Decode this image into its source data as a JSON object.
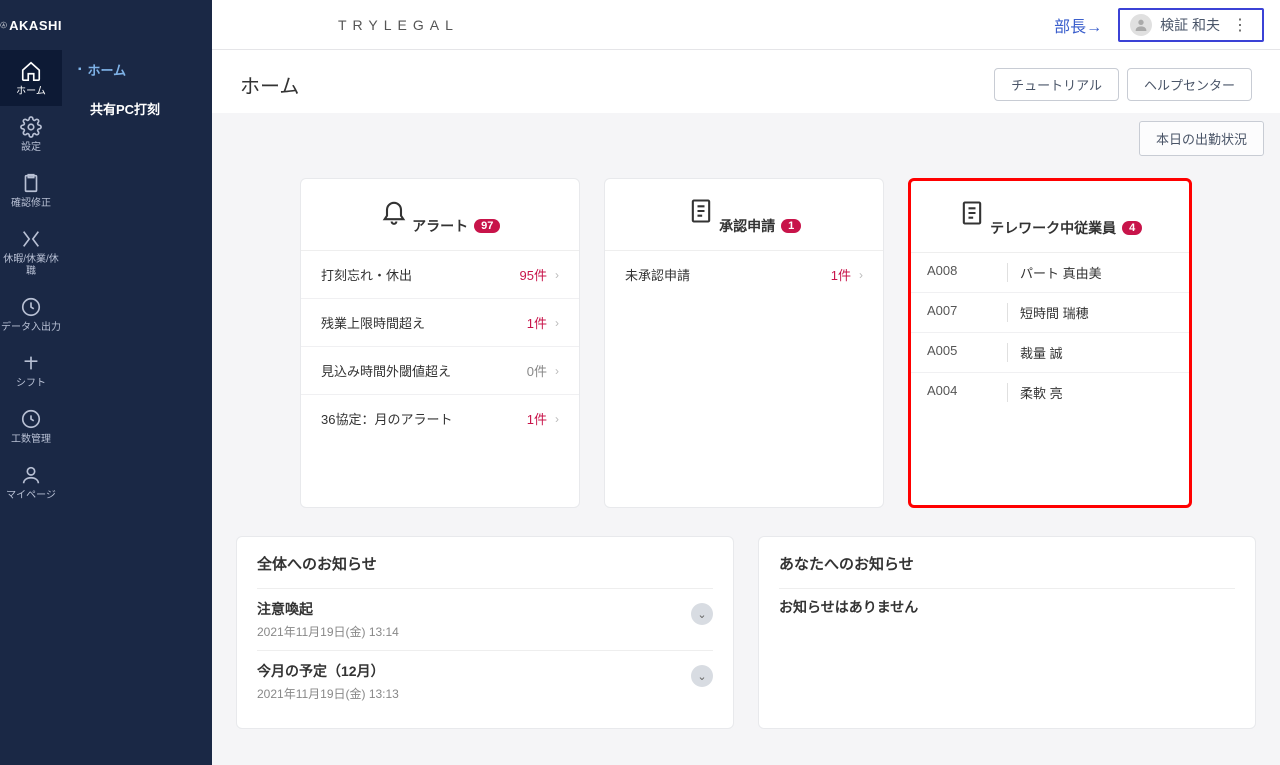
{
  "logo": "AKASHI",
  "icon_rail": [
    {
      "label": "ホーム"
    },
    {
      "label": "設定"
    },
    {
      "label": "確認修正"
    },
    {
      "label": "休暇/休業/休職"
    },
    {
      "label": "データ入出力"
    },
    {
      "label": "シフト"
    },
    {
      "label": "工数管理"
    },
    {
      "label": "マイページ"
    }
  ],
  "sub_sidebar": [
    {
      "label": "ホーム"
    },
    {
      "label": "共有PC打刻"
    }
  ],
  "topbar": {
    "brand": "TRYLEGAL",
    "role": "部長→",
    "username": "検証 和夫"
  },
  "page": {
    "title": "ホーム",
    "tutorial_btn": "チュートリアル",
    "help_btn": "ヘルプセンター",
    "status_btn": "本日の出勤状況"
  },
  "alerts": {
    "title": "アラート",
    "count": "97",
    "items": [
      {
        "label": "打刻忘れ・休出",
        "value": "95件",
        "zero": false
      },
      {
        "label": "残業上限時間超え",
        "value": "1件",
        "zero": false
      },
      {
        "label": "見込み時間外閾値超え",
        "value": "0件",
        "zero": true
      },
      {
        "label": "36協定：月のアラート",
        "value": "1件",
        "zero": false
      }
    ]
  },
  "approvals": {
    "title": "承認申請",
    "count": "1",
    "items": [
      {
        "label": "未承認申請",
        "value": "1件"
      }
    ]
  },
  "telework": {
    "title": "テレワーク中従業員",
    "count": "4",
    "items": [
      {
        "id": "A008",
        "name": "パート 真由美"
      },
      {
        "id": "A007",
        "name": "短時間 瑞穂"
      },
      {
        "id": "A005",
        "name": "裁量 誠"
      },
      {
        "id": "A004",
        "name": "柔軟 亮"
      }
    ]
  },
  "notices_all": {
    "heading": "全体へのお知らせ",
    "items": [
      {
        "title": "注意喚起",
        "time": "2021年11月19日(金) 13:14"
      },
      {
        "title": "今月の予定（12月）",
        "time": "2021年11月19日(金) 13:13"
      }
    ]
  },
  "notices_you": {
    "heading": "あなたへのお知らせ",
    "empty": "お知らせはありません"
  }
}
